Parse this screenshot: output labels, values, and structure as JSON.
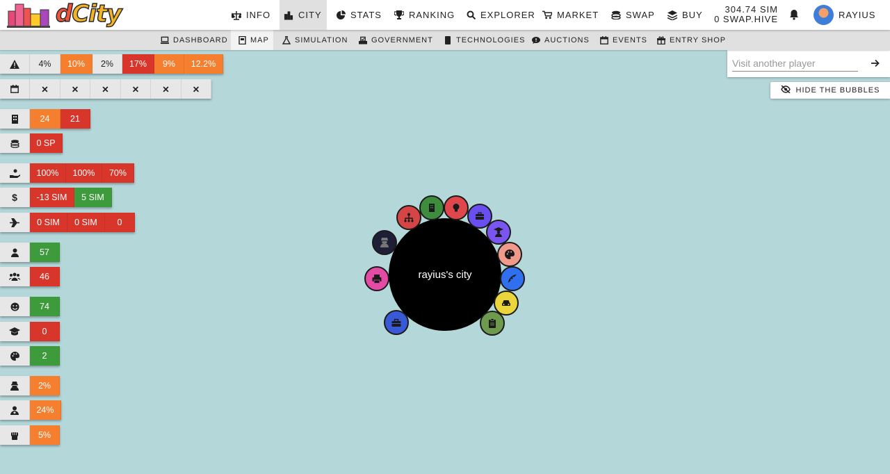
{
  "app": {
    "logo_text_d": "d",
    "logo_text_city": "City"
  },
  "nav": {
    "items": [
      {
        "label": "INFO",
        "icon": "scale-icon"
      },
      {
        "label": "CITY",
        "icon": "city-icon"
      },
      {
        "label": "STATS",
        "icon": "pie-chart-icon"
      },
      {
        "label": "RANKING",
        "icon": "trophy-icon"
      },
      {
        "label": "EXPLORER",
        "icon": "search-icon"
      },
      {
        "label": "MARKET",
        "icon": "cart-icon"
      },
      {
        "label": "SWAP",
        "icon": "coins-icon"
      },
      {
        "label": "BUY",
        "icon": "layers-icon"
      }
    ],
    "active": "CITY",
    "balance_sim": "304.74 SIM",
    "balance_swap": "0 SWAP.HIVE",
    "username": "RAYIUS"
  },
  "subnav": {
    "items": [
      {
        "label": "DASHBOARD",
        "icon": "laptop-icon"
      },
      {
        "label": "MAP",
        "icon": "map-icon"
      },
      {
        "label": "SIMULATION",
        "icon": "flask-icon"
      },
      {
        "label": "GOVERNMENT",
        "icon": "vote-icon"
      },
      {
        "label": "TECHNOLOGIES",
        "icon": "chip-icon"
      },
      {
        "label": "AUCTIONS",
        "icon": "chat-icon"
      },
      {
        "label": "EVENTS",
        "icon": "calendar-icon"
      },
      {
        "label": "ENTRY SHOP",
        "icon": "gift-icon"
      }
    ],
    "active": "MAP"
  },
  "stats": {
    "warning": [
      "4%",
      "10%",
      "2%",
      "17%",
      "9%",
      "12.2%"
    ],
    "calendar": [
      "✕",
      "✕",
      "✕",
      "✕",
      "✕",
      "✕"
    ],
    "buildings": [
      "24",
      "21"
    ],
    "coins": [
      "0 SP"
    ],
    "hands": [
      "100%",
      "100%",
      "70%"
    ],
    "dollar": [
      "-13 SIM",
      "5 SIM"
    ],
    "plane": [
      "0 SIM",
      "0 SIM",
      "0"
    ],
    "person": [
      "57"
    ],
    "people": [
      "46"
    ],
    "smile": [
      "74"
    ],
    "graduation": [
      "0"
    ],
    "palette": [
      "2"
    ],
    "thief": [
      "2%"
    ],
    "doctor": [
      "24%"
    ],
    "fist": [
      "5%"
    ]
  },
  "visit": {
    "placeholder": "Visit another player"
  },
  "hide_bubbles_label": "HIDE THE BUBBLES",
  "city": {
    "name": "rayius's city"
  },
  "colors": {
    "orange": "#f57f2e",
    "red": "#d9362b",
    "green": "#3e9b3c",
    "map_bg": "#b4d7da"
  }
}
